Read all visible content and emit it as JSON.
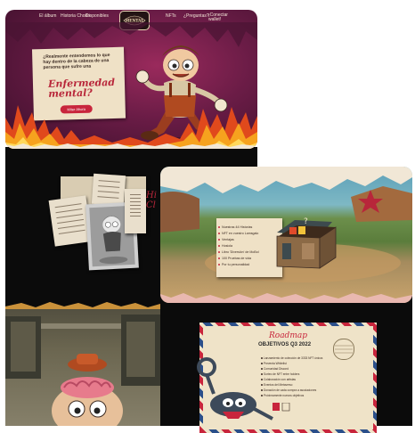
{
  "hero": {
    "nav": {
      "item1": "El álbum",
      "item2": "Historia Chorlo",
      "item3": "Disponibles",
      "item4": "NFTs",
      "item5": "¿Preguntas?",
      "item6": "¡Conectar wallet!"
    },
    "logo_text": "MENTAL HEALTH",
    "question": "¿Realmente entendemos lo que hay dentro de la cabeza de una persona que sufre una",
    "headline": "Enfermedad mental?",
    "cta": "Miter Ahora"
  },
  "letters": {
    "side_heading": "Hi Cl"
  },
  "chest_list": {
    "items": [
      "Nuestras 44 Historias",
      "NFT en vuestro Lamsgalo",
      "Ventajas",
      "Hosiola",
      "Libro 'Diversión' de MoBol",
      "100 Pruebas de vida",
      "Por tu personalidad"
    ]
  },
  "roadmap": {
    "title": "Roadmap",
    "subtitle": "OBJETIVOS Q3 2022",
    "items": [
      "Lanzamiento de colección de 3333 NFT únicos",
      "Preventa Whitelist",
      "Comunidad Discord",
      "Sorteo de NFT entre holders",
      "Colaboración con artistas",
      "Eventos del Metaverso",
      "Donación de cada compra a asociaciones",
      "Próximamente nuevos objetivos"
    ]
  },
  "colors": {
    "accent_red": "#c8253c",
    "paper": "#efe1c6",
    "hero_bg": "#6a1c46",
    "black": "#0b0b0b"
  }
}
